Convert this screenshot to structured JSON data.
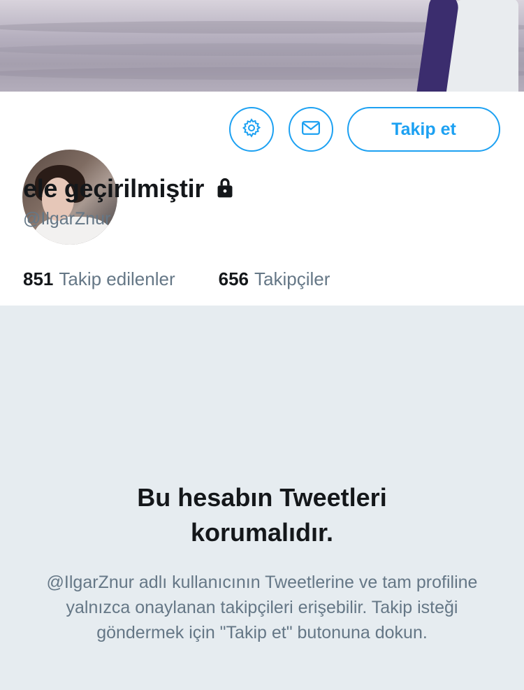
{
  "profile": {
    "display_name": "ele geçirilmiştir",
    "handle": "@IlgarZnur",
    "follow_label": "Takip et",
    "lock_icon": "lock-icon",
    "settings_icon": "gear-icon",
    "message_icon": "envelope-icon"
  },
  "stats": [
    {
      "value": "851",
      "label": "Takip edilenler"
    },
    {
      "value": "656",
      "label": "Takipçiler"
    }
  ],
  "protected_notice": {
    "title": "Bu hesabın Tweetleri korumalıdır.",
    "body": "@IlgarZnur adlı kullanıcının Tweetlerine ve tam profiline yalnızca onaylanan takipçileri erişebilir. Takip isteği göndermek için \"Takip et\" butonuna dokun."
  },
  "colors": {
    "accent": "#1da1f2",
    "secondary_text": "#657786",
    "background": "#e6ecf0"
  }
}
